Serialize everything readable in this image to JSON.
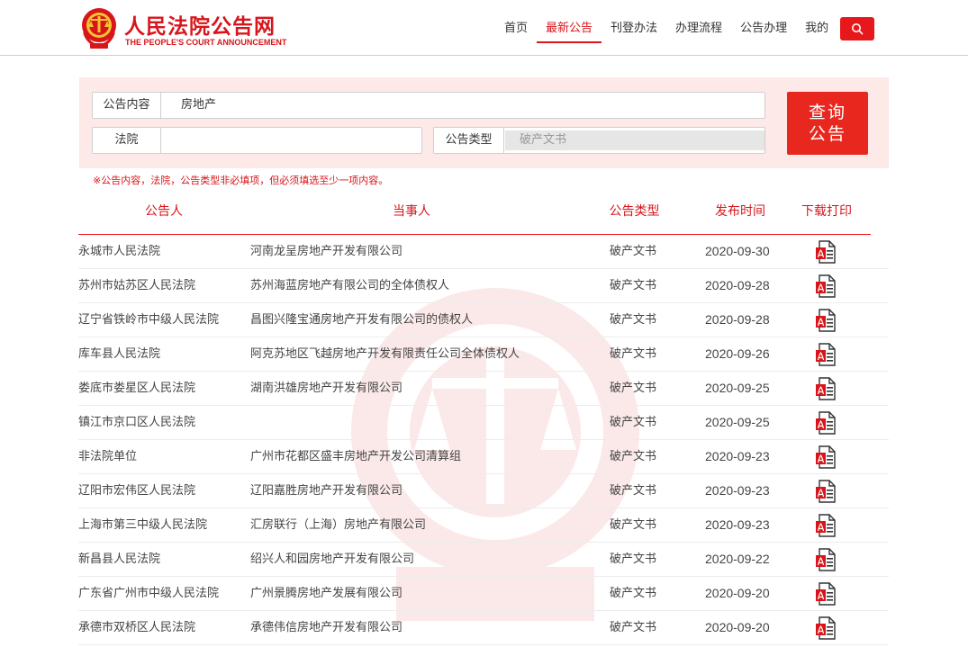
{
  "site": {
    "title": "人民法院公告网",
    "subtitle": "THE PEOPLE'S COURT ANNOUNCEMENT"
  },
  "nav": {
    "items": [
      {
        "label": "首页",
        "active": false
      },
      {
        "label": "最新公告",
        "active": true
      },
      {
        "label": "刊登办法",
        "active": false
      },
      {
        "label": "办理流程",
        "active": false
      },
      {
        "label": "公告办理",
        "active": false
      },
      {
        "label": "我的",
        "active": false
      }
    ],
    "search_icon": "search-icon"
  },
  "query": {
    "content_label": "公告内容",
    "content_value": "房地产",
    "court_label": "法院",
    "court_value": "",
    "type_label": "公告类型",
    "type_value": "破产文书",
    "button_line1": "查询",
    "button_line2": "公告",
    "note": "※公告内容，法院，公告类型非必填项，但必须填选至少一项内容。"
  },
  "table": {
    "headers": [
      "公告人",
      "当事人",
      "公告类型",
      "发布时间",
      "下载打印"
    ],
    "rows": [
      {
        "publisher": "永城市人民法院",
        "party": "河南龙呈房地产开发有限公司",
        "type": "破产文书",
        "date": "2020-09-30"
      },
      {
        "publisher": "苏州市姑苏区人民法院",
        "party": "苏州海蓝房地产有限公司的全体债权人",
        "type": "破产文书",
        "date": "2020-09-28"
      },
      {
        "publisher": "辽宁省铁岭市中级人民法院",
        "party": "昌图兴隆宝通房地产开发有限公司的债权人",
        "type": "破产文书",
        "date": "2020-09-28"
      },
      {
        "publisher": "库车县人民法院",
        "party": "阿克苏地区飞越房地产开发有限责任公司全体债权人",
        "type": "破产文书",
        "date": "2020-09-26"
      },
      {
        "publisher": "娄底市娄星区人民法院",
        "party": "湖南洪雄房地产开发有限公司",
        "type": "破产文书",
        "date": "2020-09-25"
      },
      {
        "publisher": "镇江市京口区人民法院",
        "party": "",
        "type": "破产文书",
        "date": "2020-09-25"
      },
      {
        "publisher": "非法院单位",
        "party": "广州市花都区盛丰房地产开发公司清算组",
        "type": "破产文书",
        "date": "2020-09-23"
      },
      {
        "publisher": "辽阳市宏伟区人民法院",
        "party": "辽阳嘉胜房地产开发有限公司",
        "type": "破产文书",
        "date": "2020-09-23"
      },
      {
        "publisher": "上海市第三中级人民法院",
        "party": "汇房联行（上海）房地产有限公司",
        "type": "破产文书",
        "date": "2020-09-23"
      },
      {
        "publisher": "新昌县人民法院",
        "party": "绍兴人和园房地产开发有限公司",
        "type": "破产文书",
        "date": "2020-09-22"
      },
      {
        "publisher": "广东省广州市中级人民法院",
        "party": "广州景腾房地产发展有限公司",
        "type": "破产文书",
        "date": "2020-09-20"
      },
      {
        "publisher": "承德市双桥区人民法院",
        "party": "承德伟信房地产开发有限公司",
        "type": "破产文书",
        "date": "2020-09-20"
      }
    ],
    "download_icon": "pdf-download-icon"
  },
  "colors": {
    "brand_red": "#d8151b",
    "panel_bg": "#fde9e7",
    "button_red": "#e8281e"
  }
}
